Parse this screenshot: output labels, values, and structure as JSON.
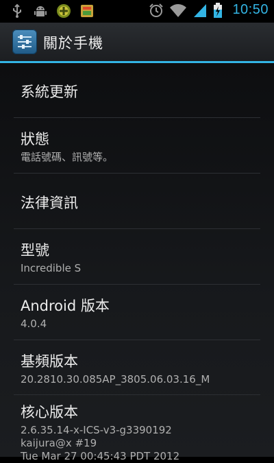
{
  "status_bar": {
    "left_icons": [
      "usb-icon",
      "android-debug-icon",
      "app-notification-icon",
      "app-notification-2-icon"
    ],
    "right_icons": [
      "alarm-icon",
      "wifi-icon",
      "signal-icon",
      "battery-charging-icon"
    ],
    "time": "10:50",
    "time_color": "#33b5e5"
  },
  "action_bar": {
    "title": "關於手機",
    "icon": "settings-sliders-icon"
  },
  "accent_color": "#33b5e5",
  "items": [
    {
      "label": "系統更新",
      "summary": ""
    },
    {
      "label": "狀態",
      "summary": "電話號碼、訊號等。"
    },
    {
      "label": "法律資訊",
      "summary": ""
    },
    {
      "label": "型號",
      "summary": "Incredible S"
    },
    {
      "label": "Android 版本",
      "summary": "4.0.4"
    },
    {
      "label": "基頻版本",
      "summary": "20.2810.30.085AP_3805.06.03.16_M"
    },
    {
      "label": "核心版本",
      "summary_lines": [
        "2.6.35.14-x-ICS-v3-g3390192",
        "kaijura@x #19",
        "Tue Mar 27 00:45:43 PDT 2012"
      ]
    }
  ]
}
